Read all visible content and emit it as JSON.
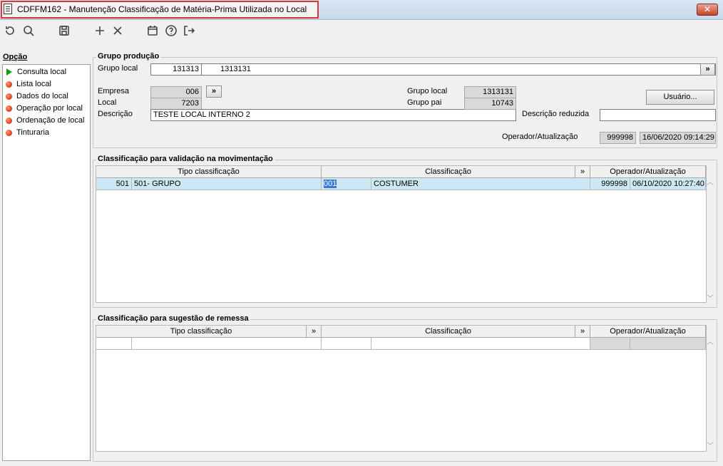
{
  "window": {
    "title": "CDFFM162 - Manutenção Classificação de Matéria-Prima Utilizada no Local",
    "close_label": "✕"
  },
  "toolbar": {
    "icons": [
      "refresh-icon",
      "search-icon",
      "save-icon",
      "add-icon",
      "delete-icon",
      "calendar-icon",
      "help-icon",
      "exit-icon"
    ]
  },
  "sidebar": {
    "title": "Opção",
    "items": [
      {
        "label": "Consulta local",
        "selected": true
      },
      {
        "label": "Lista local"
      },
      {
        "label": "Dados do local"
      },
      {
        "label": "Operação por local"
      },
      {
        "label": "Ordenação de local"
      },
      {
        "label": "Tinturaria"
      }
    ]
  },
  "grupo_producao": {
    "title": "Grupo produção",
    "grupo_local_label": "Grupo local",
    "grupo_local_code": "131313",
    "grupo_local_value": "1313131",
    "more_label": "»",
    "empresa_label": "Empresa",
    "empresa_value": "006",
    "local_label": "Local",
    "local_value": "7203",
    "descricao_label": "Descrição",
    "descricao_value": "TESTE LOCAL INTERNO 2",
    "grupo_local2_label": "Grupo local",
    "grupo_local2_value": "1313131",
    "grupo_pai_label": "Grupo pai",
    "grupo_pai_value": "10743",
    "usuario_button": "Usuário...",
    "descricao_reduzida_label": "Descrição reduzida",
    "descricao_reduzida_value": "",
    "operador_label": "Operador/Atualização",
    "operador_value": "999998",
    "atualizacao_value": "16/06/2020 09:14:29"
  },
  "validacao": {
    "title": "Classificação para validação na movimentação",
    "columns": {
      "tipo": "Tipo classificação",
      "classificacao": "Classificação",
      "more": "»",
      "operador": "Operador/Atualização"
    },
    "rows": [
      {
        "tipo_code": "501",
        "tipo_desc": "501- GRUPO",
        "class_code": "001",
        "class_desc": "COSTUMER",
        "operador": "999998",
        "data": "06/10/2020 10:27:40"
      }
    ]
  },
  "remessa": {
    "title": "Classificação para sugestão de remessa",
    "columns": {
      "tipo": "Tipo classificação",
      "more": "»",
      "classificacao": "Classificação",
      "operador": "Operador/Atualização"
    }
  },
  "colors": {
    "selected_row": "#cce8f4",
    "highlight": "#3a7bd5",
    "title_border": "#d43a3a"
  }
}
